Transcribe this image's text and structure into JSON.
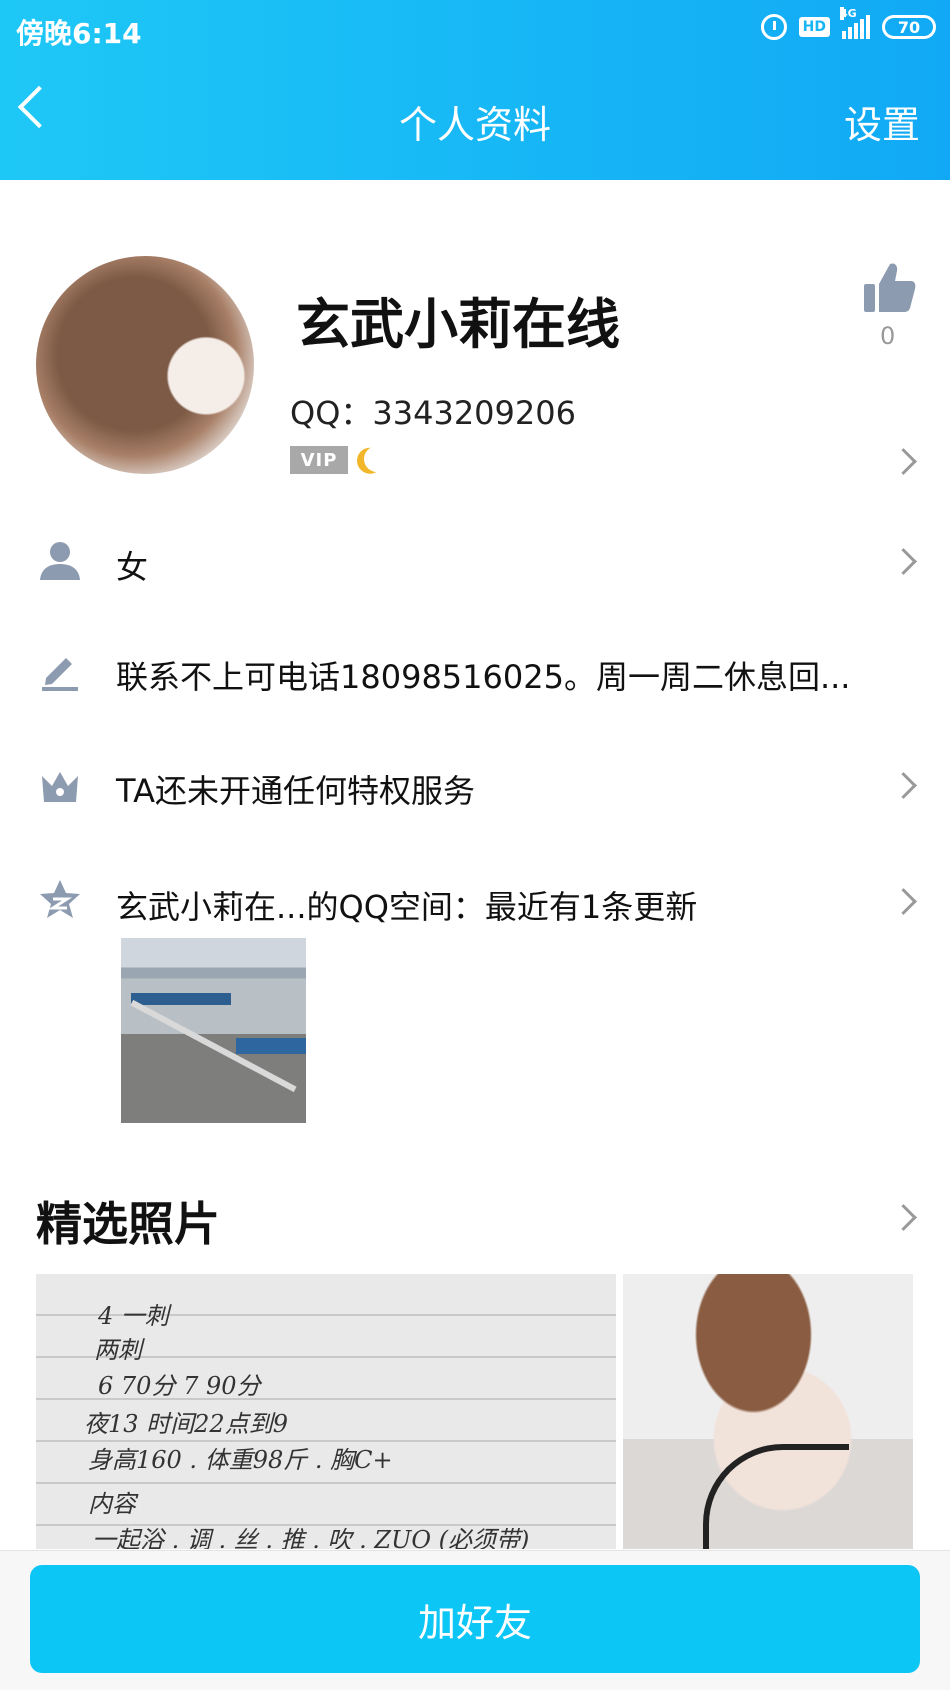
{
  "status_bar": {
    "time": "傍晚6:14",
    "hd": "HD",
    "network": "4G",
    "battery": "70"
  },
  "header": {
    "title": "个人资料",
    "settings": "设置"
  },
  "profile": {
    "name": "玄武小莉在线",
    "qq": "QQ：3343209206",
    "vip_badge": "VIP",
    "like_count": "0"
  },
  "rows": {
    "gender": "女",
    "signature": "联系不上可电话18098516025。周一周二休息回...",
    "privilege": "TA还未开通任何特权服务",
    "qzone": "玄武小莉在...的QQ空间：最近有1条更新"
  },
  "featured": {
    "title": "精选照片",
    "note_lines": [
      "4  一刺",
      "两刺",
      "6  70分       7  90分",
      "夜13    时间22点到9",
      "身高160 . 体重98斤  . 胸C+",
      "内容",
      "一起浴 . 调 . 丝 . 推 . 吹 . ZUO (必须带)"
    ]
  },
  "actions": {
    "add_friend": "加好友"
  },
  "colors": {
    "header_start": "#1ec8f6",
    "header_end": "#11a9f5",
    "button": "#0cc6f6"
  }
}
